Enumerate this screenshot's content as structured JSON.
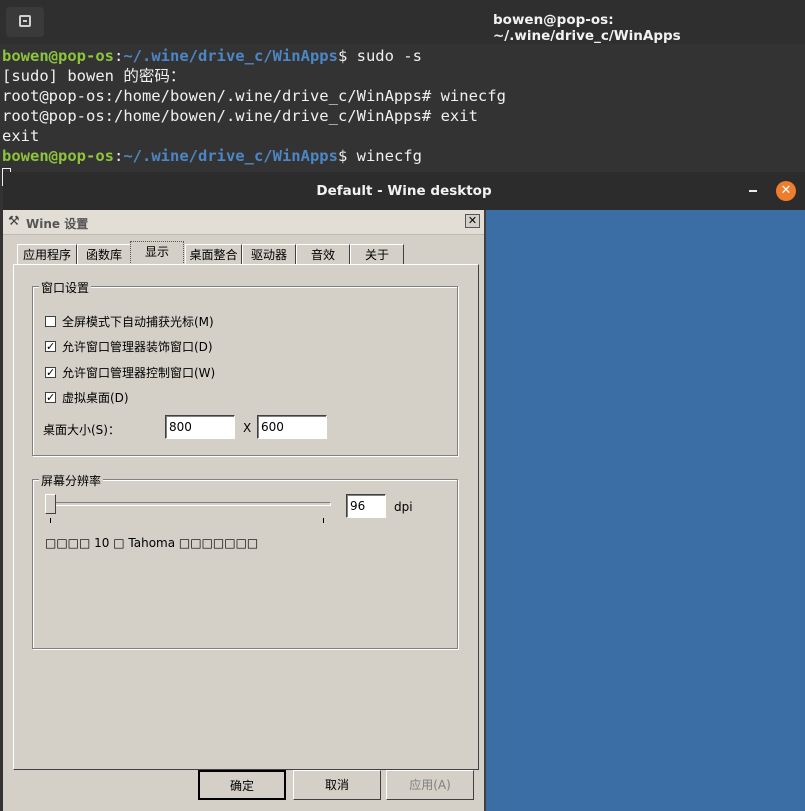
{
  "terminal": {
    "title": "bowen@pop-os: ~/.wine/drive_c/WinApps",
    "lines": [
      {
        "user": "bowen@pop-os",
        "sep": ":",
        "path": "~/.wine/drive_c/WinApps",
        "cmd": "$ sudo -s"
      },
      {
        "text": "[sudo] bowen 的密码："
      },
      {
        "text": "root@pop-os:/home/bowen/.wine/drive_c/WinApps# winecfg"
      },
      {
        "text": "root@pop-os:/home/bowen/.wine/drive_c/WinApps# exit"
      },
      {
        "text": "exit"
      },
      {
        "user": "bowen@pop-os",
        "sep": ":",
        "path": "~/.wine/drive_c/WinApps",
        "cmd": "$ winecfg"
      }
    ]
  },
  "wine_window": {
    "title": "Default - Wine desktop",
    "close_symbol": "✕",
    "desktop_color": "#3a6ea5"
  },
  "dialog": {
    "title": "Wine 设置",
    "close_symbol": "✕",
    "tabs": [
      "应用程序",
      "函数库",
      "显示",
      "桌面整合",
      "驱动器",
      "音效",
      "关于"
    ],
    "active_tab": "显示",
    "window_settings": {
      "label": "窗口设置",
      "checkboxes": [
        {
          "label": "全屏模式下自动捕获光标(M)",
          "checked": false
        },
        {
          "label": "允许窗口管理器装饰窗口(D)",
          "checked": true
        },
        {
          "label": "允许窗口管理器控制窗口(W)",
          "checked": true
        },
        {
          "label": "虚拟桌面(D)",
          "checked": true
        }
      ],
      "desktop_size_label": "桌面大小(S)：",
      "width": "800",
      "separator": "X",
      "height": "600"
    },
    "resolution": {
      "label": "屏幕分辨率",
      "dpi_value": "96",
      "dpi_unit": "dpi",
      "sample_text": "□□□□ 10 □ Tahoma □□□□□□□"
    },
    "buttons": {
      "ok": "确定",
      "cancel": "取消",
      "apply": "应用(A)"
    }
  }
}
